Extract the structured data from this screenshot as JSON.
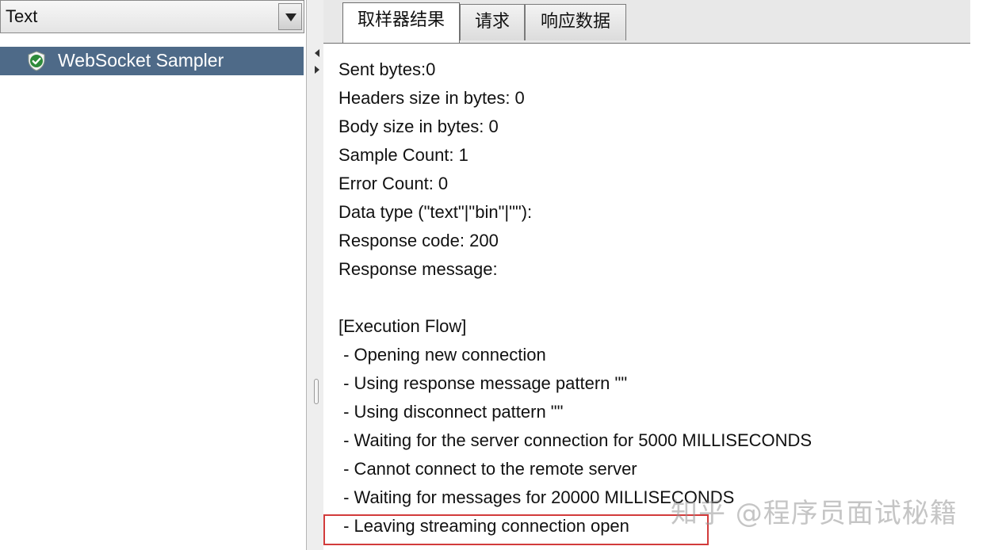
{
  "left_panel": {
    "renderer_select": {
      "value": "Text"
    },
    "tree": [
      {
        "label": "WebSocket Sampler",
        "icon": "shield-check-icon",
        "status": "success"
      }
    ]
  },
  "tabs": [
    {
      "label": "取样器结果",
      "active": true
    },
    {
      "label": "请求",
      "active": false
    },
    {
      "label": "响应数据",
      "active": false
    }
  ],
  "sampler_result": {
    "lines": [
      "Sent bytes:0",
      "Headers size in bytes: 0",
      "Body size in bytes: 0",
      "Sample Count: 1",
      "Error Count: 0",
      "Data type (\"text\"|\"bin\"|\"\"):",
      "Response code: 200",
      "Response message:",
      "",
      "[Execution Flow]",
      " - Opening new connection",
      " - Using response message pattern \"\"",
      " - Using disconnect pattern \"\"",
      " - Waiting for the server connection for 5000 MILLISECONDS",
      " - Cannot connect to the remote server",
      " - Waiting for messages for 20000 MILLISECONDS",
      " - Leaving streaming connection open"
    ]
  },
  "watermark": "知乎 @程序员面试秘籍",
  "colors": {
    "selection": "#4e6a88",
    "highlight_border": "#d23b3b",
    "success_icon": "#2e8b3a"
  }
}
